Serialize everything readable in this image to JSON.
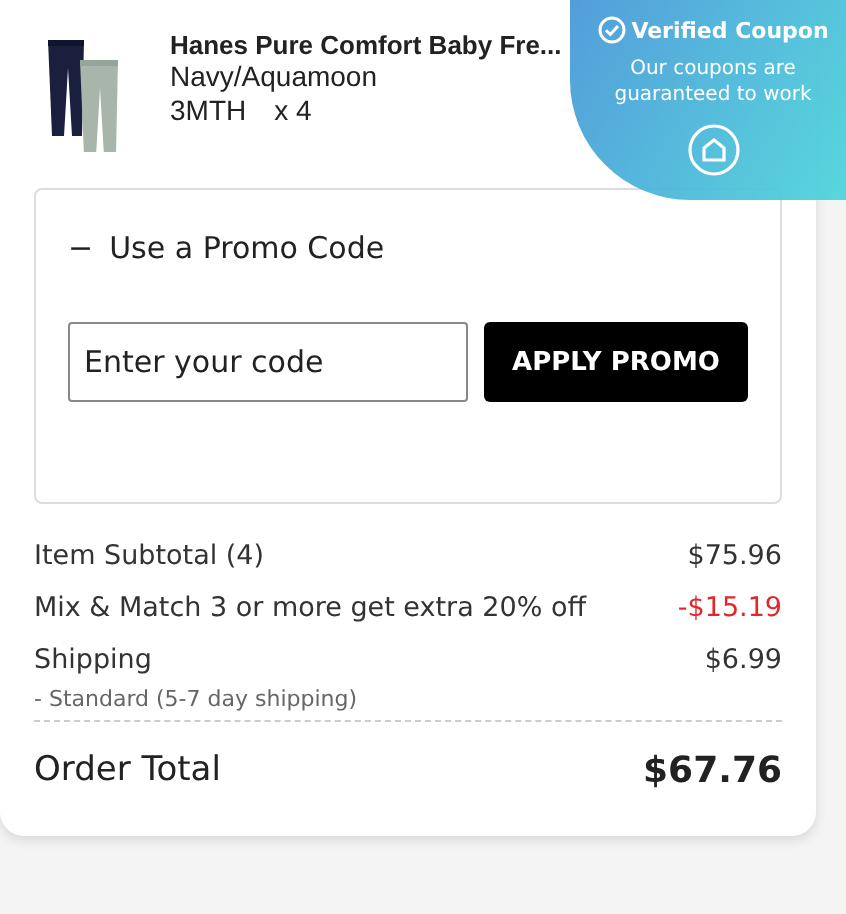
{
  "product": {
    "name": "Hanes Pure Comfort Baby Fre...",
    "variant": "Navy/Aquamoon",
    "size": "3MTH",
    "quantity": "x  4"
  },
  "badge": {
    "title": "Verified Coupon",
    "text": "Our coupons are guaranteed to work"
  },
  "promo": {
    "toggle": "−",
    "title": "Use a Promo Code",
    "placeholder": "Enter your code",
    "button": "APPLY PROMO"
  },
  "summary": [
    {
      "label": "Item Subtotal (4)",
      "value": "$75.96",
      "discount": false
    },
    {
      "label": "Mix & Match 3 or more get extra 20% off",
      "value": "-$15.19",
      "discount": true
    },
    {
      "label": "Shipping",
      "value": "$6.99",
      "discount": false,
      "note": "- Standard (5-7 day shipping)"
    }
  ],
  "total": {
    "label": "Order Total",
    "value": "$67.76"
  }
}
